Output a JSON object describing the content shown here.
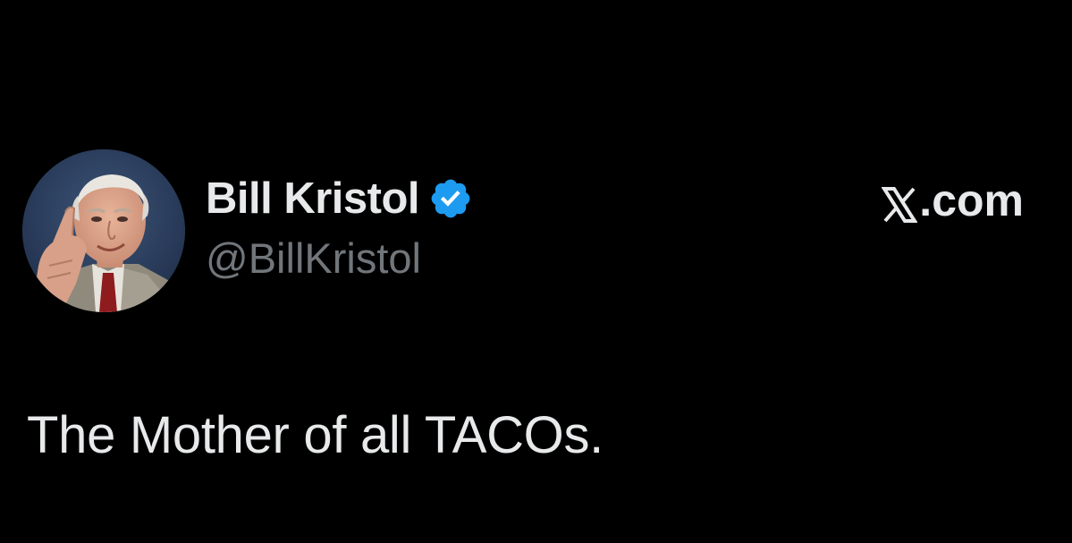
{
  "author": {
    "display_name": "Bill Kristol",
    "handle": "@BillKristol",
    "verified": true
  },
  "site": {
    "label": ".com",
    "logo_icon": "x-logo-icon"
  },
  "tweet": {
    "text": "The Mother of all TACOs."
  },
  "colors": {
    "background": "#000000",
    "primary_text": "#e7e9ea",
    "secondary_text": "#71767b",
    "verified_badge": "#1d9bf0"
  }
}
